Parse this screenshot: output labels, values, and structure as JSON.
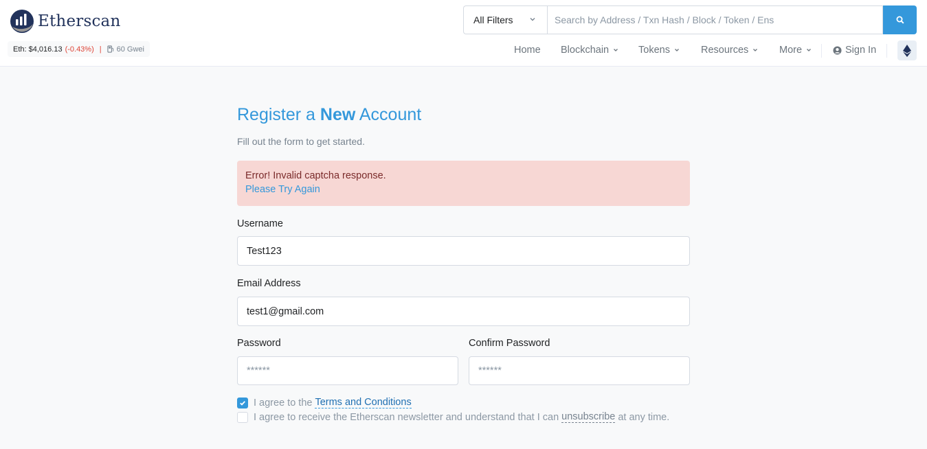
{
  "brand": {
    "name": "Etherscan"
  },
  "price_bar": {
    "eth_label": "Eth: $4,016.13",
    "change": "(-0.43%)",
    "separator": "|",
    "gas": "60 Gwei"
  },
  "search": {
    "filter_label": "All Filters",
    "placeholder": "Search by Address / Txn Hash / Block / Token / Ens"
  },
  "nav": {
    "home": "Home",
    "blockchain": "Blockchain",
    "tokens": "Tokens",
    "resources": "Resources",
    "more": "More",
    "sign_in": "Sign In"
  },
  "form": {
    "title_pre": "Register a ",
    "title_bold": "New",
    "title_post": " Account",
    "subtitle": "Fill out the form to get started.",
    "alert_error": "Error! Invalid captcha response.",
    "alert_link": "Please Try Again",
    "username_label": "Username",
    "username_value": "Test123",
    "email_label": "Email Address",
    "email_value": "test1@gmail.com",
    "password_label": "Password",
    "password_placeholder": "******",
    "confirm_label": "Confirm Password",
    "confirm_placeholder": "******",
    "terms_prefix": "I agree to the",
    "terms_link": "Terms and Conditions",
    "terms_checked": true,
    "newsletter_prefix": "I agree to receive the Etherscan newsletter and understand that I can",
    "newsletter_link": "unsubscribe",
    "newsletter_suffix": "at any time.",
    "newsletter_checked": false
  },
  "colors": {
    "accent": "#3498db",
    "alert_bg": "#f7d7d4",
    "negative": "#de4437",
    "brand_dark": "#21325b"
  }
}
